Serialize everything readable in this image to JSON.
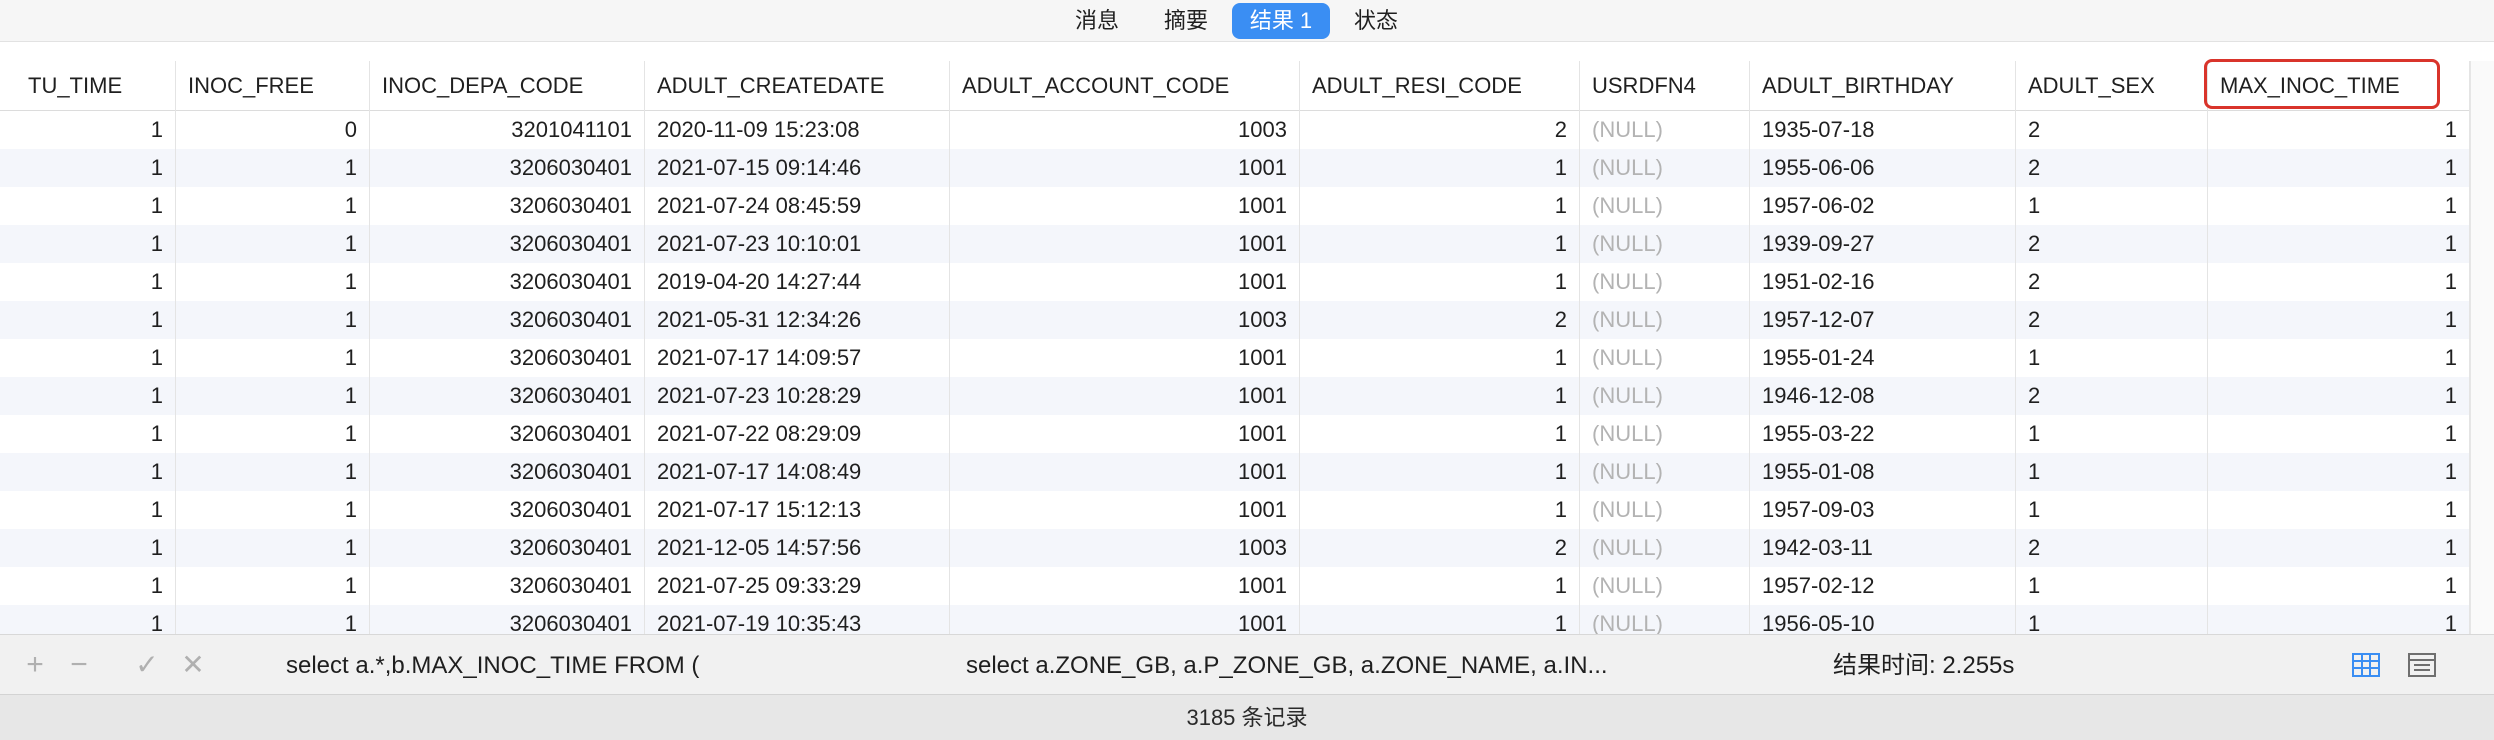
{
  "tabs": [
    "消息",
    "摘要",
    "结果 1",
    "状态"
  ],
  "active_tab": "结果 1",
  "columns": [
    "TU_TIME",
    "INOC_FREE",
    "INOC_DEPA_CODE",
    "ADULT_CREATEDATE",
    "ADULT_ACCOUNT_CODE",
    "ADULT_RESI_CODE",
    "USRDFN4",
    "ADULT_BIRTHDAY",
    "ADULT_SEX",
    "MAX_INOC_TIME"
  ],
  "highlighted_column": "MAX_INOC_TIME",
  "highlight_color": "#d9342b",
  "rows": [
    [
      "1",
      "0",
      "3201041101",
      "2020-11-09 15:23:08",
      "1003",
      "2",
      "(NULL)",
      "1935-07-18",
      "2",
      "1"
    ],
    [
      "1",
      "1",
      "3206030401",
      "2021-07-15 09:14:46",
      "1001",
      "1",
      "(NULL)",
      "1955-06-06",
      "2",
      "1"
    ],
    [
      "1",
      "1",
      "3206030401",
      "2021-07-24 08:45:59",
      "1001",
      "1",
      "(NULL)",
      "1957-06-02",
      "1",
      "1"
    ],
    [
      "1",
      "1",
      "3206030401",
      "2021-07-23 10:10:01",
      "1001",
      "1",
      "(NULL)",
      "1939-09-27",
      "2",
      "1"
    ],
    [
      "1",
      "1",
      "3206030401",
      "2019-04-20 14:27:44",
      "1001",
      "1",
      "(NULL)",
      "1951-02-16",
      "2",
      "1"
    ],
    [
      "1",
      "1",
      "3206030401",
      "2021-05-31 12:34:26",
      "1003",
      "2",
      "(NULL)",
      "1957-12-07",
      "2",
      "1"
    ],
    [
      "1",
      "1",
      "3206030401",
      "2021-07-17 14:09:57",
      "1001",
      "1",
      "(NULL)",
      "1955-01-24",
      "1",
      "1"
    ],
    [
      "1",
      "1",
      "3206030401",
      "2021-07-23 10:28:29",
      "1001",
      "1",
      "(NULL)",
      "1946-12-08",
      "2",
      "1"
    ],
    [
      "1",
      "1",
      "3206030401",
      "2021-07-22 08:29:09",
      "1001",
      "1",
      "(NULL)",
      "1955-03-22",
      "1",
      "1"
    ],
    [
      "1",
      "1",
      "3206030401",
      "2021-07-17 14:08:49",
      "1001",
      "1",
      "(NULL)",
      "1955-01-08",
      "1",
      "1"
    ],
    [
      "1",
      "1",
      "3206030401",
      "2021-07-17 15:12:13",
      "1001",
      "1",
      "(NULL)",
      "1957-09-03",
      "1",
      "1"
    ],
    [
      "1",
      "1",
      "3206030401",
      "2021-12-05 14:57:56",
      "1003",
      "2",
      "(NULL)",
      "1942-03-11",
      "2",
      "1"
    ],
    [
      "1",
      "1",
      "3206030401",
      "2021-07-25 09:33:29",
      "1001",
      "1",
      "(NULL)",
      "1957-02-12",
      "1",
      "1"
    ],
    [
      "1",
      "1",
      "3206030401",
      "2021-07-19 10:35:43",
      "1001",
      "1",
      "(NULL)",
      "1956-05-10",
      "1",
      "1"
    ]
  ],
  "toolbar": {
    "add_icon": "plus-icon",
    "remove_icon": "minus-icon",
    "apply_icon": "check-icon",
    "discard_icon": "close-icon",
    "query_text": "select a.*,b.MAX_INOC_TIME FROM (",
    "subquery_text": "select  a.ZONE_GB, a.P_ZONE_GB, a.ZONE_NAME, a.IN...",
    "result_time": "结果时间: 2.255s",
    "grid_view_icon": "grid-view-icon",
    "form_view_icon": "form-view-icon"
  },
  "status": {
    "record_count": "3185 条记录"
  },
  "colors": {
    "accent": "#3a8ef3",
    "null_text": "#b3b3b3",
    "alt_row": "#f4f6fb"
  }
}
